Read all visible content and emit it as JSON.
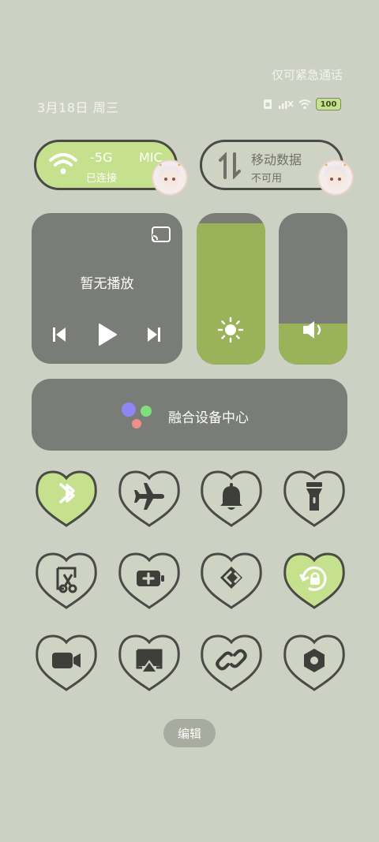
{
  "status_bar": {
    "emergency_text": "仅可紧急通话",
    "date_text": "3月18日 周三",
    "battery_level": "100",
    "icons": [
      "sim-card-icon",
      "no-signal-icon",
      "wifi-icon",
      "battery-icon"
    ]
  },
  "wifi_pill": {
    "main": "-5G",
    "extra": "MIC",
    "sub": "已连接",
    "icon": "wifi-icon"
  },
  "data_pill": {
    "main": "移动数据",
    "sub": "不可用",
    "icon": "mobile-data-icon"
  },
  "media": {
    "label": "暂无播放",
    "icons": [
      "cast-icon",
      "previous-icon",
      "play-icon",
      "next-icon"
    ]
  },
  "brightness": {
    "level": 0.93,
    "icon": "sun-icon"
  },
  "volume": {
    "level": 0.27,
    "icon": "speaker-icon"
  },
  "fusion": {
    "label": "融合设备中心",
    "icon": "assistant-dots-icon"
  },
  "tiles": [
    {
      "name": "bluetooth",
      "icon": "bluetooth-icon",
      "active": true
    },
    {
      "name": "airplane",
      "icon": "airplane-icon",
      "active": false
    },
    {
      "name": "bell",
      "icon": "bell-icon",
      "active": false
    },
    {
      "name": "flashlight",
      "icon": "flashlight-icon",
      "active": false
    },
    {
      "name": "screenshot",
      "icon": "screenshot-scissors-icon",
      "active": false
    },
    {
      "name": "battery-saver",
      "icon": "battery-plus-icon",
      "active": false
    },
    {
      "name": "share",
      "icon": "share-arrow-icon",
      "active": false
    },
    {
      "name": "rotation-lock",
      "icon": "rotation-lock-icon",
      "active": true
    },
    {
      "name": "screen-record",
      "icon": "video-camera-icon",
      "active": false
    },
    {
      "name": "screen-cast",
      "icon": "screen-cast-icon",
      "active": false
    },
    {
      "name": "link",
      "icon": "link-icon",
      "active": false
    },
    {
      "name": "nfc",
      "icon": "hexagon-icon",
      "active": false
    }
  ],
  "colors": {
    "active_green": "#c5e18e",
    "inactive": "#cfd3c3",
    "card": "#7a7d77",
    "slider_fill": "#9ab259",
    "outline": "#4a4a47"
  },
  "edit_label": "编辑"
}
